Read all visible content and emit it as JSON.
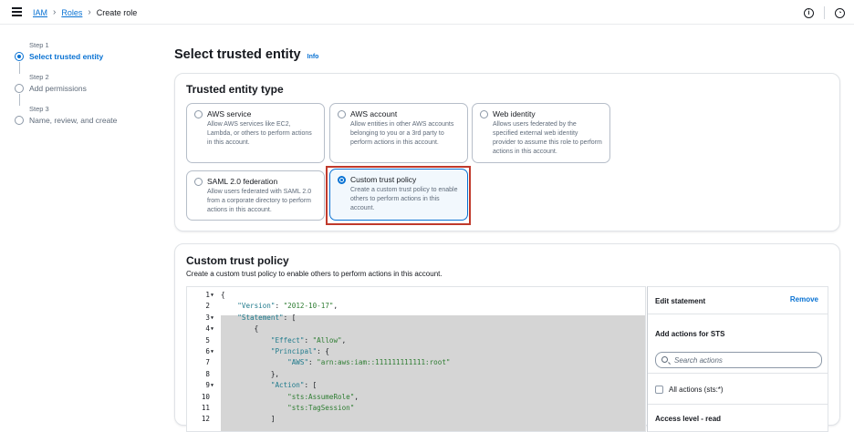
{
  "breadcrumb": {
    "items": [
      "IAM",
      "Roles"
    ],
    "current": "Create role"
  },
  "header_icons": {
    "info": "info-icon",
    "settings": "notification-icon"
  },
  "steps": [
    {
      "label": "Step 1",
      "title": "Select trusted entity",
      "active": true
    },
    {
      "label": "Step 2",
      "title": "Add permissions",
      "active": false
    },
    {
      "label": "Step 3",
      "title": "Name, review, and create",
      "active": false
    }
  ],
  "page": {
    "title": "Select trusted entity",
    "info_link": "Info"
  },
  "trusted_entity": {
    "heading": "Trusted entity type",
    "options": [
      {
        "name": "AWS service",
        "desc": "Allow AWS services like EC2, Lambda, or others to perform actions in this account.",
        "selected": false
      },
      {
        "name": "AWS account",
        "desc": "Allow entities in other AWS accounts belonging to you or a 3rd party to perform actions in this account.",
        "selected": false
      },
      {
        "name": "Web identity",
        "desc": "Allows users federated by the specified external web identity provider to assume this role to perform actions in this account.",
        "selected": false
      },
      {
        "name": "SAML 2.0 federation",
        "desc": "Allow users federated with SAML 2.0 from a corporate directory to perform actions in this account.",
        "selected": false
      },
      {
        "name": "Custom trust policy",
        "desc": "Create a custom trust policy to enable others to perform actions in this account.",
        "selected": true
      }
    ]
  },
  "custom_policy": {
    "heading": "Custom trust policy",
    "description": "Create a custom trust policy to enable others to perform actions in this account.",
    "code_lines": [
      {
        "n": "1",
        "fold": true,
        "text": "{"
      },
      {
        "n": "2",
        "fold": false,
        "text": "    \"Version\": \"2012-10-17\","
      },
      {
        "n": "3",
        "fold": true,
        "text": "    \"Statement\": ["
      },
      {
        "n": "4",
        "fold": true,
        "text": "        {"
      },
      {
        "n": "5",
        "fold": false,
        "text": "            \"Effect\": \"Allow\","
      },
      {
        "n": "6",
        "fold": true,
        "text": "            \"Principal\": {"
      },
      {
        "n": "7",
        "fold": false,
        "text": "                \"AWS\": \"arn:aws:iam::111111111111:root\""
      },
      {
        "n": "8",
        "fold": false,
        "text": "            },"
      },
      {
        "n": "9",
        "fold": true,
        "text": "            \"Action\": ["
      },
      {
        "n": "10",
        "fold": false,
        "text": "                \"sts:AssumeRole\","
      },
      {
        "n": "11",
        "fold": false,
        "text": "                \"sts:TagSession\""
      },
      {
        "n": "12",
        "fold": false,
        "text": "            ]"
      }
    ]
  },
  "statement_panel": {
    "title": "Edit statement",
    "remove": "Remove",
    "add_actions": "Add actions for STS",
    "search_placeholder": "Search actions",
    "all_actions": "All actions (sts:*)",
    "access_level": "Access level - read"
  }
}
